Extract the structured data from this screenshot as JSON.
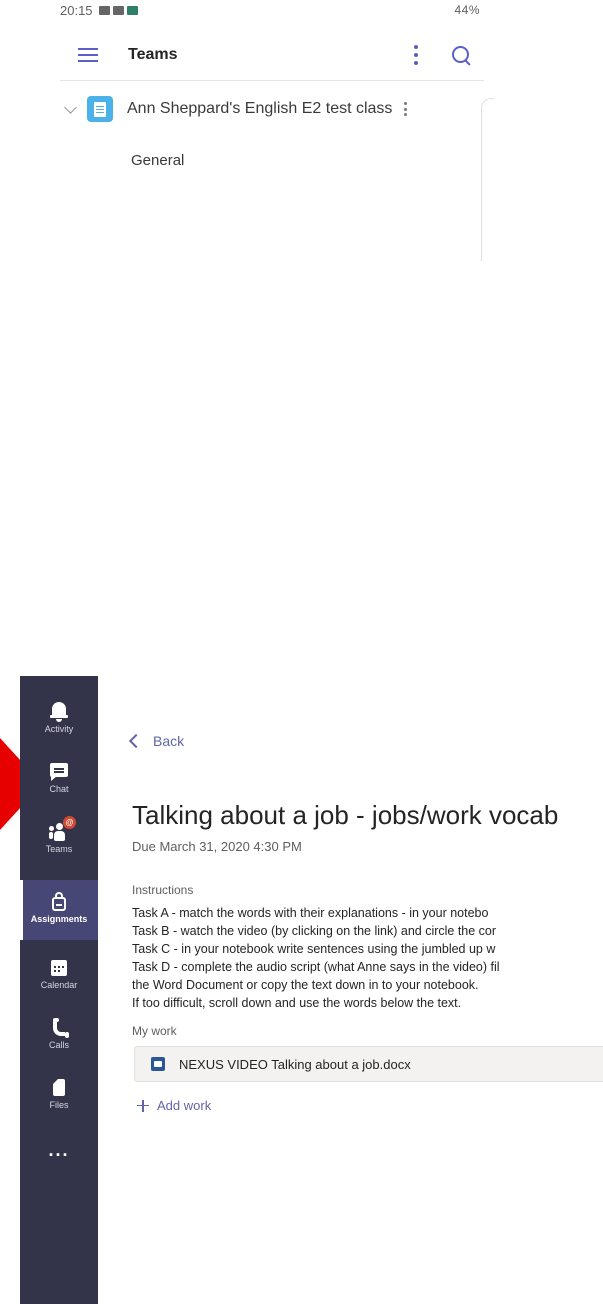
{
  "phone": {
    "status": {
      "time": "20:15",
      "right": "44%"
    },
    "appbar": {
      "title": "Teams"
    },
    "team": {
      "name": "Ann Sheppard's English E2 test class"
    },
    "channel": "General"
  },
  "rail": {
    "items": [
      {
        "label": "Activity",
        "icon": "bell-icon"
      },
      {
        "label": "Chat",
        "icon": "chat-icon"
      },
      {
        "label": "Teams",
        "icon": "teams-icon",
        "badge": "@"
      },
      {
        "label": "Assignments",
        "icon": "assignments-icon",
        "active": true
      },
      {
        "label": "Calendar",
        "icon": "calendar-icon"
      },
      {
        "label": "Calls",
        "icon": "phone-icon"
      },
      {
        "label": "Files",
        "icon": "file-icon"
      }
    ],
    "more": "..."
  },
  "assignment": {
    "back": "Back",
    "title": "Talking about a job - jobs/work vocab",
    "due": "Due March 31, 2020 4:30 PM",
    "instructions_label": "Instructions",
    "instructions": [
      "Task A - match the words with their explanations - in your notebo",
      "Task B - watch the video (by clicking on the link) and circle the cor",
      "Task C - in your notebook write sentences using the jumbled up w",
      "Task D - complete the audio script (what Anne says in the video) fil",
      "the Word Document or copy the text down in to your notebook.",
      "If too difficult, scroll down and use the words below the text."
    ],
    "my_work_label": "My work",
    "file": "NEXUS VIDEO Talking about a job.docx",
    "add_work": "Add work"
  },
  "colors": {
    "accent": "#6264a7",
    "rail": "#33344a",
    "pointer": "#e60000",
    "badge": "#cc4a31"
  }
}
